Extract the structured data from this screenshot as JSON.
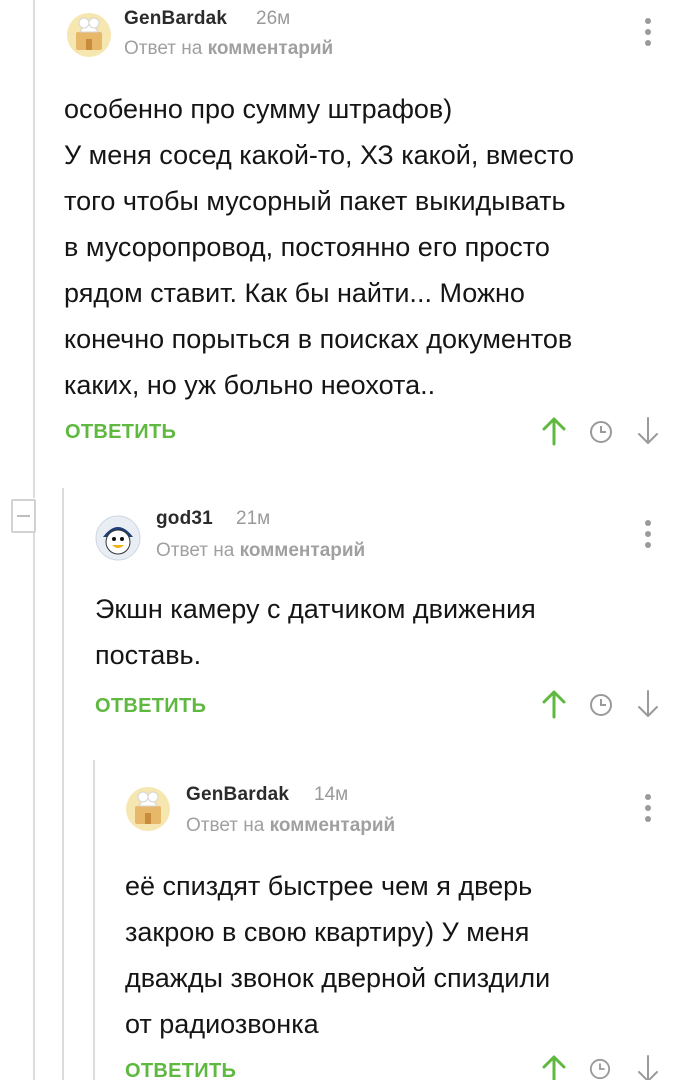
{
  "comments": [
    {
      "username": "GenBardak",
      "time": "26м",
      "reply_prefix": "Ответ на",
      "reply_target": "комментарий",
      "text_lines": [
        "особенно про сумму штрафов)",
        "У меня сосед какой-то, ХЗ какой, вместо",
        "того чтобы мусорный пакет выкидывать",
        "в мусоропровод, постоянно его просто",
        "рядом ставит. Как бы найти... Можно",
        "конечно порыться в поисках документов",
        "каких, но уж больно неохота.."
      ],
      "reply_label": "ОТВЕТИТЬ"
    },
    {
      "username": "god31",
      "time": "21м",
      "reply_prefix": "Ответ на",
      "reply_target": "комментарий",
      "text_lines": [
        "Экшн камеру с датчиком движения",
        "поставь."
      ],
      "reply_label": "ОТВЕТИТЬ"
    },
    {
      "username": "GenBardak",
      "time": "14м",
      "reply_prefix": "Ответ на",
      "reply_target": "комментарий",
      "text_lines": [
        "её спиздят быстрее чем я дверь",
        "закрою в свою квартиру) У меня",
        "дважды звонок дверной спиздили",
        "от радиозвонка"
      ],
      "reply_label": "ОТВЕТИТЬ"
    }
  ],
  "icons": {
    "upvote": "arrow-up-icon",
    "history": "clock-icon",
    "downvote": "arrow-down-icon",
    "menu": "more-vertical-icon",
    "collapse": "minus-icon"
  },
  "colors": {
    "accent": "#5fb83f",
    "muted": "#9a9a9a",
    "thread_line": "#dcdcdc"
  }
}
